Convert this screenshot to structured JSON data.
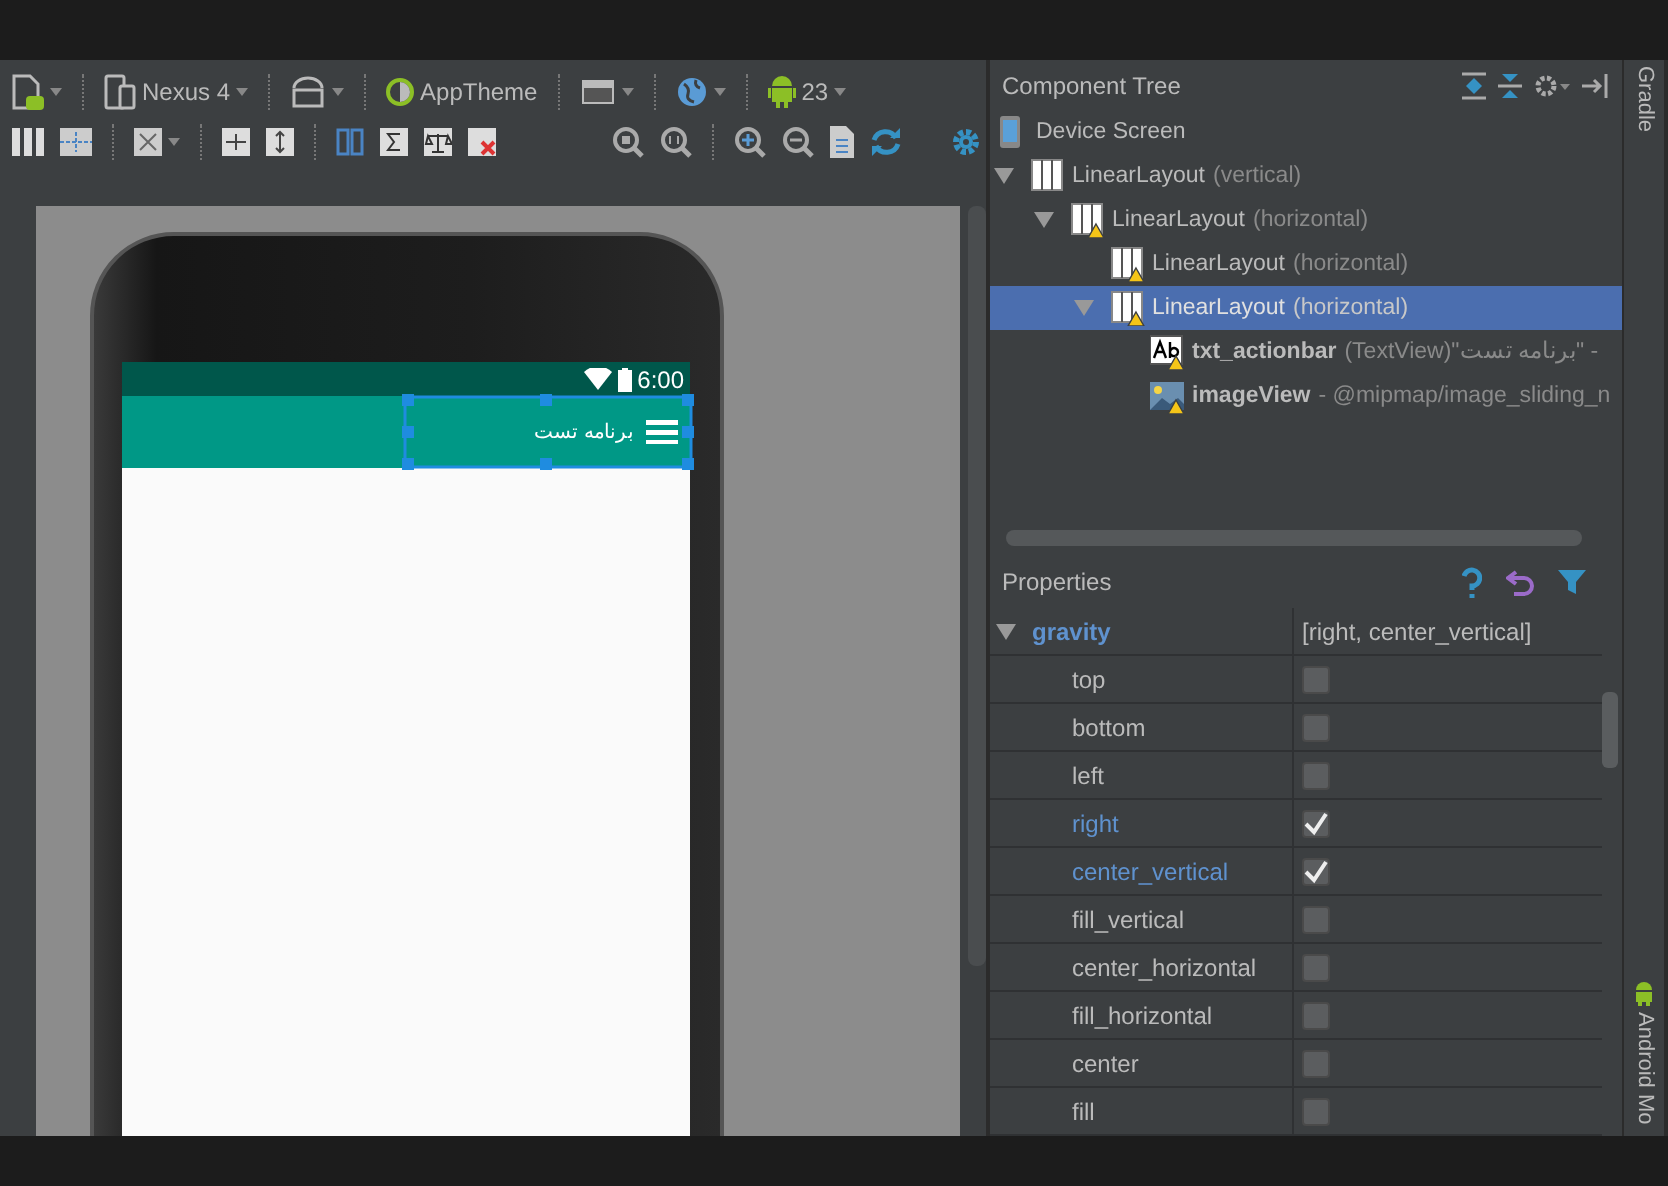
{
  "toolbar": {
    "device": "Nexus 4",
    "theme": "AppTheme",
    "api_level": "23"
  },
  "phone": {
    "time": "6:00",
    "app_title": "برنامه تست",
    "title_selected": true
  },
  "component_tree": {
    "title": "Component Tree",
    "items": [
      {
        "kind": "device",
        "name": "Device Screen",
        "warning": false,
        "selected": false
      },
      {
        "kind": "layout",
        "name": "LinearLayout",
        "detail": "(vertical)",
        "warning": false,
        "selected": false,
        "expanded": true,
        "children": [
          {
            "kind": "layout",
            "name": "LinearLayout",
            "detail": "(horizontal)",
            "warning": true,
            "selected": false,
            "expanded": true,
            "children": [
              {
                "kind": "layout",
                "name": "LinearLayout",
                "detail": "(horizontal)",
                "warning": true,
                "selected": false
              },
              {
                "kind": "layout",
                "name": "LinearLayout",
                "detail": "(horizontal)",
                "warning": true,
                "selected": true,
                "expanded": true,
                "children": [
                  {
                    "kind": "text",
                    "name": "txt_actionbar",
                    "detail": "(TextView)\"برنامه تست\" -",
                    "warning": true,
                    "selected": false
                  },
                  {
                    "kind": "image",
                    "name": "imageView",
                    "detail": "- @mipmap/image_sliding_n",
                    "warning": true,
                    "selected": false
                  }
                ]
              }
            ]
          }
        ]
      }
    ]
  },
  "properties": {
    "title": "Properties",
    "group": {
      "name": "gravity",
      "value": "[right, center_vertical]",
      "expanded": true
    },
    "flags": [
      {
        "label": "top",
        "checked": false
      },
      {
        "label": "bottom",
        "checked": false
      },
      {
        "label": "left",
        "checked": false
      },
      {
        "label": "right",
        "checked": true
      },
      {
        "label": "center_vertical",
        "checked": true
      },
      {
        "label": "fill_vertical",
        "checked": false
      },
      {
        "label": "center_horizontal",
        "checked": false
      },
      {
        "label": "fill_horizontal",
        "checked": false
      },
      {
        "label": "center",
        "checked": false
      },
      {
        "label": "fill",
        "checked": false
      }
    ]
  },
  "side_tabs": [
    "Gradle",
    "Android Mo"
  ]
}
